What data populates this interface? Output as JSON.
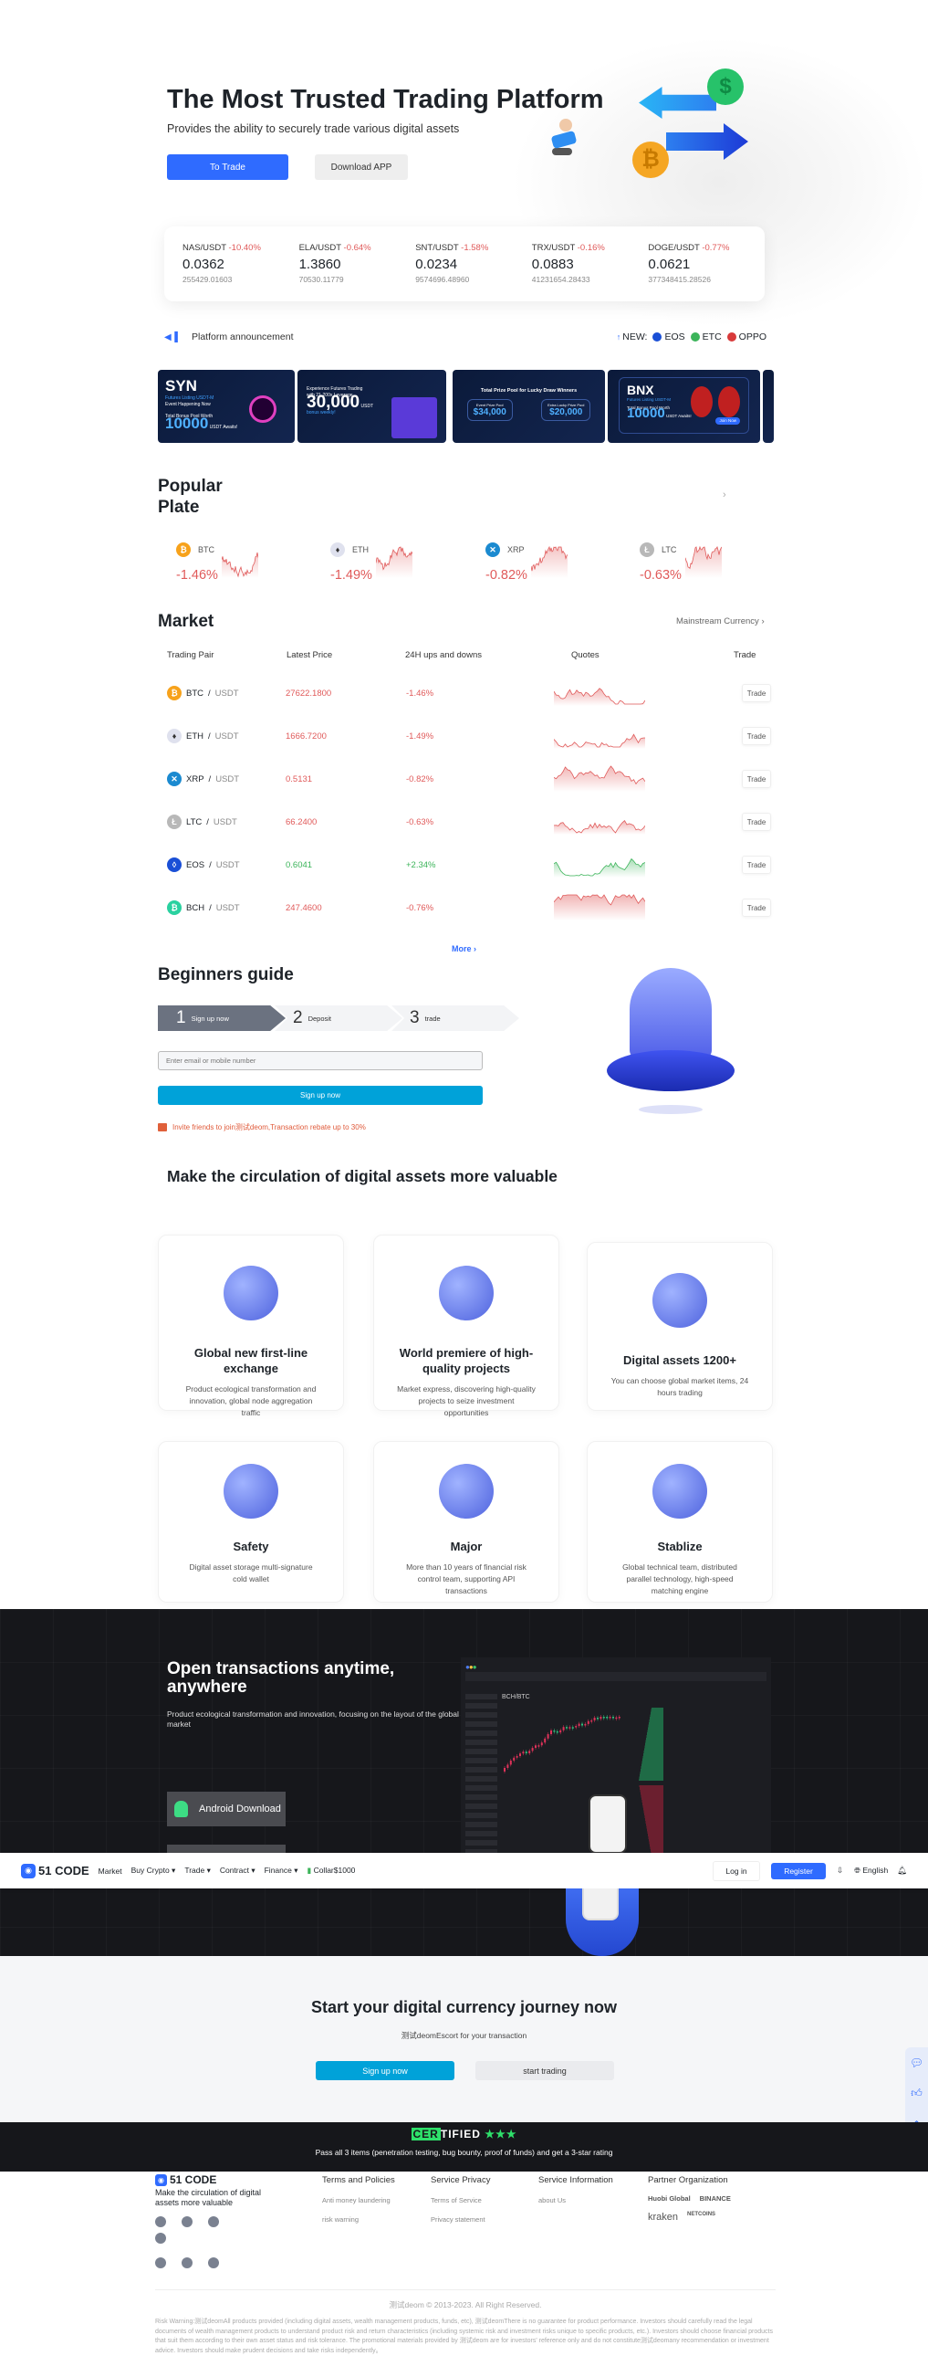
{
  "hero": {
    "title": "The Most Trusted Trading Platform",
    "subtitle": "Provides the ability to securely trade various digital assets",
    "trade_btn": "To Trade",
    "download_btn": "Download APP"
  },
  "tickers": [
    {
      "pair": "NAS/USDT",
      "change": "-10.40%",
      "price": "0.0362",
      "volume": "255429.01603"
    },
    {
      "pair": "ELA/USDT",
      "change": "-0.64%",
      "price": "1.3860",
      "volume": "70530.11779"
    },
    {
      "pair": "SNT/USDT",
      "change": "-1.58%",
      "price": "0.0234",
      "volume": "9574696.48960"
    },
    {
      "pair": "TRX/USDT",
      "change": "-0.16%",
      "price": "0.0883",
      "volume": "41231654.28433"
    },
    {
      "pair": "DOGE/USDT",
      "change": "-0.77%",
      "price": "0.0621",
      "volume": "377348415.28526"
    }
  ],
  "announcement": {
    "label": "Platform announcement",
    "new_label": "NEW:",
    "new_coins": [
      {
        "name": "EOS",
        "color": "#1a4fd6"
      },
      {
        "name": "ETC",
        "color": "#3cb45a"
      },
      {
        "name": "OPPO",
        "color": "#d83a3a"
      }
    ]
  },
  "banners": [
    {
      "title": "SYN",
      "line1": "Futures Listing USDT-M",
      "line2": "Event Happening Now",
      "line3": "Total Bonus Pool Worth",
      "big": "10000",
      "unit": "USDT Awaits!"
    },
    {
      "line1": "Experience Futures Trading",
      "line2": "with 21-200x Leverage",
      "big": "30,000",
      "unit": "USDT",
      "line3": "bonus weekly!"
    },
    {
      "title": "Total Prize Pool for Lucky Draw Winners",
      "big": "$34,000",
      "big2": "$20,000",
      "line1": "Event Prize Pool",
      "line2": "Extra Lucky Prize Pool"
    },
    {
      "title": "BNX",
      "line1": "Futures Listing USDT-M",
      "line3": "Total Bonus Pool Worth",
      "big": "10000",
      "unit": "USDT Awaits!",
      "cta": "Join Now"
    }
  ],
  "popular": {
    "title_line1": "Popular",
    "title_line2": "Plate",
    "items": [
      {
        "coin": "BTC",
        "change": "-1.46%",
        "color": "#f7a21b"
      },
      {
        "coin": "ETH",
        "change": "-1.49%",
        "color": "#dfe1ee"
      },
      {
        "coin": "XRP",
        "change": "-0.82%",
        "color": "#1b8ad0"
      },
      {
        "coin": "LTC",
        "change": "-0.63%",
        "color": "#b8b8b8"
      }
    ]
  },
  "market": {
    "title": "Market",
    "filter": "Mainstream Currency",
    "headers": [
      "Trading Pair",
      "Latest Price",
      "24H ups and downs",
      "Quotes",
      "Trade"
    ],
    "rows": [
      {
        "base": "BTC",
        "quote": "USDT",
        "price": "27622.1800",
        "change": "-1.46%",
        "trend": "down",
        "color": "#f7a21b",
        "btn": "Trade"
      },
      {
        "base": "ETH",
        "quote": "USDT",
        "price": "1666.7200",
        "change": "-1.49%",
        "trend": "down",
        "color": "#dfe1ee",
        "btn": "Trade"
      },
      {
        "base": "XRP",
        "quote": "USDT",
        "price": "0.5131",
        "change": "-0.82%",
        "trend": "down",
        "color": "#1b8ad0",
        "btn": "Trade"
      },
      {
        "base": "LTC",
        "quote": "USDT",
        "price": "66.2400",
        "change": "-0.63%",
        "trend": "down",
        "color": "#b8b8b8",
        "btn": "Trade"
      },
      {
        "base": "EOS",
        "quote": "USDT",
        "price": "0.6041",
        "change": "+2.34%",
        "trend": "up",
        "color": "#1a4fd6",
        "btn": "Trade"
      },
      {
        "base": "BCH",
        "quote": "USDT",
        "price": "247.4600",
        "change": "-0.76%",
        "trend": "down",
        "color": "#2ad1a0",
        "btn": "Trade"
      }
    ],
    "more": "More"
  },
  "guide": {
    "title": "Beginners guide",
    "steps": [
      {
        "num": "1",
        "label": "Sign up now"
      },
      {
        "num": "2",
        "label": "Deposit"
      },
      {
        "num": "3",
        "label": "trade"
      }
    ],
    "input_placeholder": "Enter email or mobile number",
    "signup": "Sign up now",
    "invite": "Invite friends to join测试deom,Transaction rebate up to 30%"
  },
  "features": {
    "title": "Make the circulation of digital assets more valuable",
    "cards": [
      {
        "title": "Global new first-line exchange",
        "desc": "Product ecological transformation and innovation, global node aggregation traffic"
      },
      {
        "title": "World premiere of high-quality projects",
        "desc": "Market express, discovering high-quality projects to seize investment opportunities"
      },
      {
        "title": "Digital assets 1200+",
        "desc": "You can choose global market items, 24 hours trading"
      },
      {
        "title": "Safety",
        "desc": "Digital asset storage multi-signature cold wallet"
      },
      {
        "title": "Major",
        "desc": "More than 10 years of financial risk control team, supporting API transactions"
      },
      {
        "title": "Stablize",
        "desc": "Global technical team, distributed parallel technology, high-speed matching engine"
      }
    ]
  },
  "app": {
    "title": "Open transactions anytime, anywhere",
    "desc": "Product ecological transformation and innovation, focusing on the layout of the global market",
    "android": "Android Download",
    "pair": "BCH/BTC"
  },
  "nav": {
    "logo": "51 CODE",
    "items": [
      "Market",
      "Buy Crypto",
      "Trade",
      "Contract",
      "Finance"
    ],
    "collar": "Collar$1000",
    "login": "Log in",
    "register": "Register",
    "lang": "English"
  },
  "cta": {
    "title": "Start your digital currency journey now",
    "sub": "测试deomEscort for your transaction",
    "signup": "Sign up now",
    "trade": "start trading"
  },
  "cert": {
    "logo": "CERTIFIED",
    "stars": 3,
    "text": "Pass all 3 items (penetration testing, bug bounty, proof of funds) and get a 3-star rating"
  },
  "footer": {
    "logo": "51 CODE",
    "slogan": "Make the circulation of digital assets more valuable",
    "cols": [
      {
        "title": "Terms and Policies",
        "links": [
          "Anti money laundering",
          "risk warning"
        ]
      },
      {
        "title": "Service Privacy",
        "links": [
          "Terms of Service",
          "Privacy statement"
        ]
      },
      {
        "title": "Service Information",
        "links": [
          "about Us"
        ]
      }
    ],
    "partners_title": "Partner Organization",
    "partners": [
      "Huobi Global",
      "BINANCE",
      "kraken",
      "NETCOINS"
    ],
    "copyright": "测试deom © 2013-2023. All Right Reserved.",
    "risk": "Risk Warning:测试deomAll products provided (including digital assets, wealth management products, funds, etc), 测试deomThere is no guarantee for product performance. Investors should carefully read the legal documents of wealth management products to understand product risk and return characteristics (including systemic risk and investment risks unique to specific products, etc.). Investors should choose financial products that suit them according to their own asset status and risk tolerance. The promotional materials provided by 测试deom are for investors' reference only and do not constitute测试deomany recommendation or investment advice. Investors should make prudent decisions and take risks independently。"
  },
  "colors": {
    "primary": "#2f6bff",
    "signup": "#00a2d9",
    "down": "#e05a5a",
    "up": "#3cb45a",
    "dark": "#16171b"
  }
}
